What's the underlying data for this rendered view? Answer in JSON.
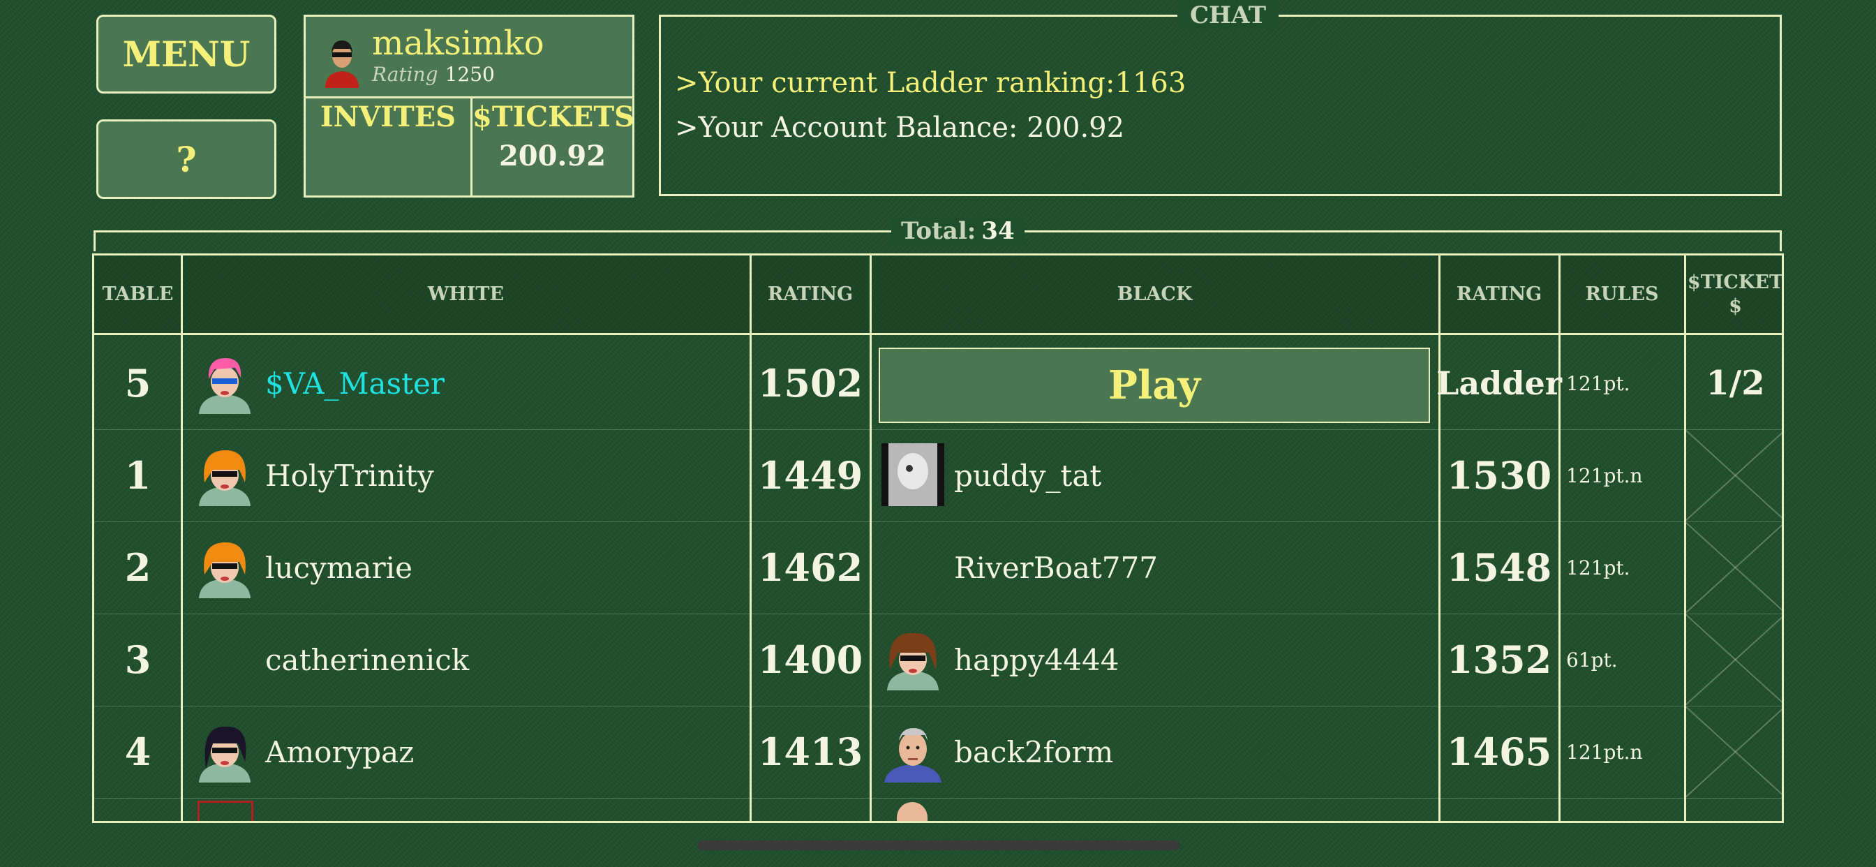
{
  "buttons": {
    "menu": "MENU",
    "help": "?"
  },
  "profile": {
    "username": "maksimko",
    "rating_label": "Rating",
    "rating": "1250",
    "invites_label": "INVITES",
    "tickets_label": "$TICKETS",
    "tickets_value": "200.92"
  },
  "chat": {
    "title": "CHAT",
    "messages": [
      ">Your current Ladder ranking:1163",
      ">Your Account Balance: 200.92"
    ]
  },
  "total": {
    "label": "Total:",
    "value": "34"
  },
  "table": {
    "headers": {
      "table": "TABLE",
      "white": "WHITE",
      "rating_white": "RATING",
      "black": "BLACK",
      "rating_black": "RATING",
      "rules": "RULES",
      "tickets": "$TICKET\n$"
    },
    "play_label": "Play",
    "rows": [
      {
        "table": "5",
        "white": "$VA_Master",
        "white_rating": "1502",
        "black": "",
        "black_rating": "Ladder",
        "rules": "121pt.",
        "tickets": "1/2"
      },
      {
        "table": "1",
        "white": "HolyTrinity",
        "white_rating": "1449",
        "black": "puddy_tat",
        "black_rating": "1530",
        "rules": "121pt.n",
        "tickets": ""
      },
      {
        "table": "2",
        "white": "lucymarie",
        "white_rating": "1462",
        "black": "RiverBoat777",
        "black_rating": "1548",
        "rules": "121pt.",
        "tickets": ""
      },
      {
        "table": "3",
        "white": "catherinenick",
        "white_rating": "1400",
        "black": "happy4444",
        "black_rating": "1352",
        "rules": "61pt.",
        "tickets": ""
      },
      {
        "table": "4",
        "white": "Amorypaz",
        "white_rating": "1413",
        "black": "back2form",
        "black_rating": "1465",
        "rules": "121pt.n",
        "tickets": ""
      }
    ]
  },
  "colors": {
    "felt": "#1f4e2c",
    "button_fill": "#4a7652",
    "border": "#e8f0c0",
    "accent_yellow": "#f4f07a",
    "vip_name": "#20e0e0"
  }
}
